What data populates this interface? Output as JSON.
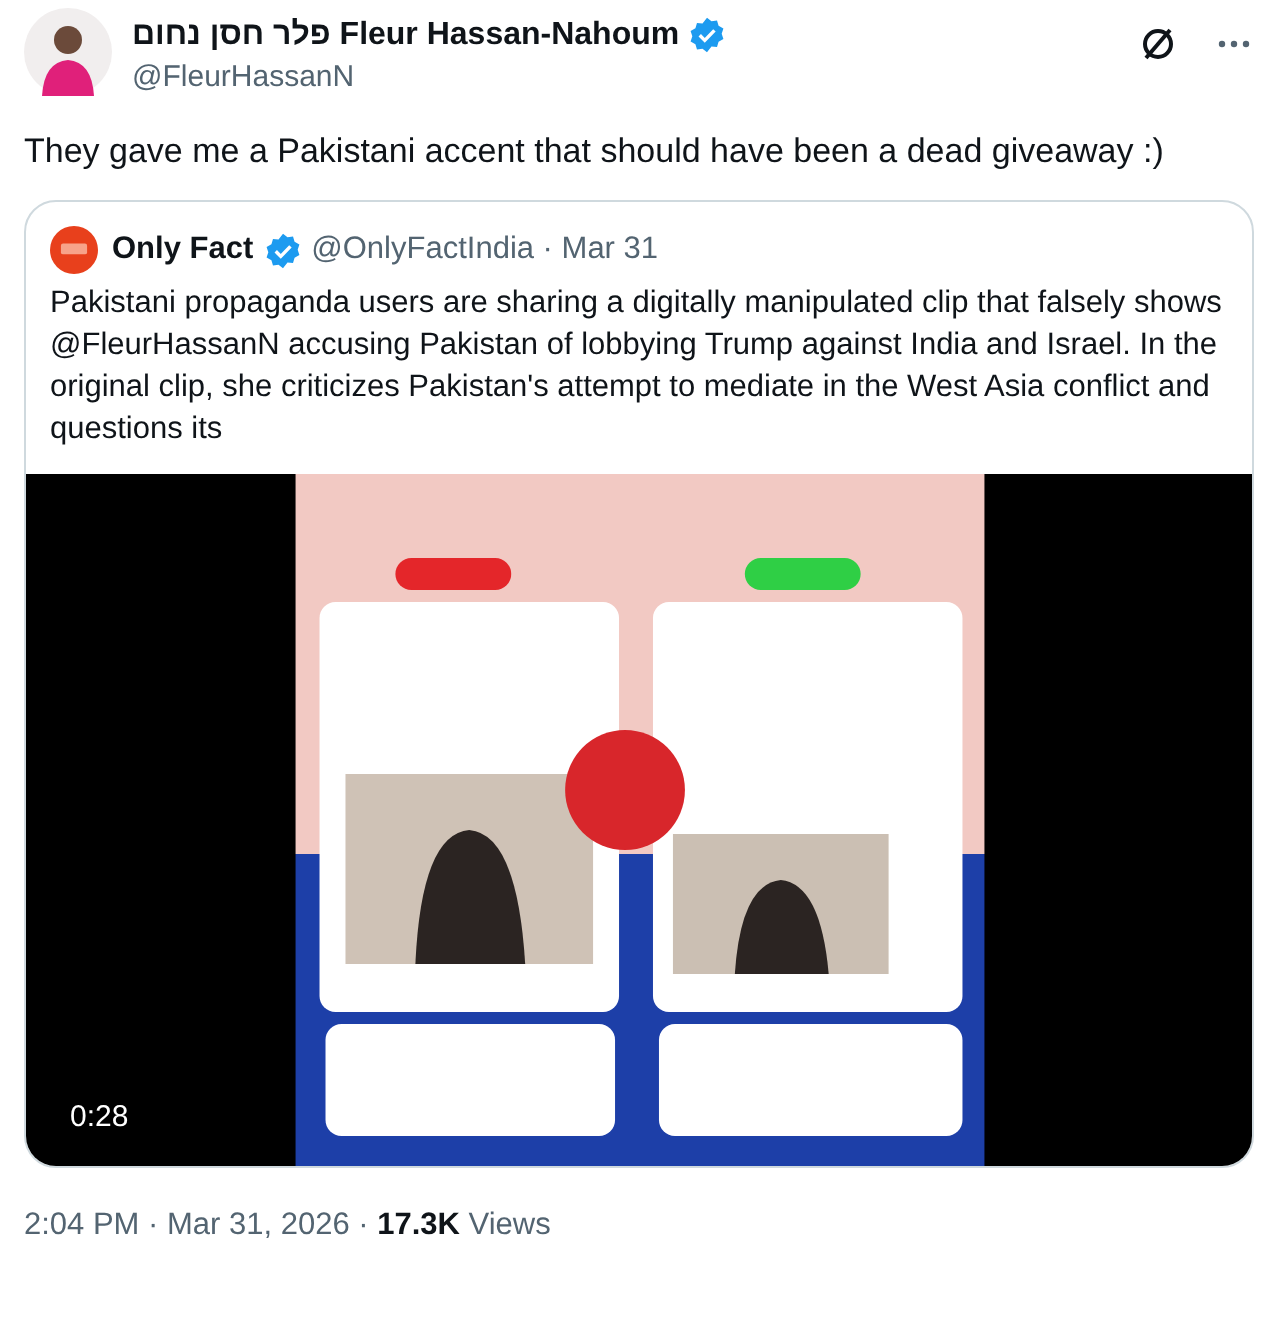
{
  "author": {
    "name": "פלר חסן נחום Fleur Hassan-Nahoum",
    "verified": true,
    "handle": "@FleurHassanN"
  },
  "text": "They gave me a Pakistani accent that should have been a dead giveaway :)",
  "quote": {
    "author": "Only Fact",
    "verified": true,
    "meta": "@OnlyFactIndia · Mar 31",
    "text": "Pakistani propaganda users are sharing a digitally manipulated clip that falsely shows @FleurHassanN accusing Pakistan of lobbying Trump against India and Israel. In the original clip, she criticizes Pakistan's attempt to mediate in the West Asia conflict and questions its",
    "media": {
      "duration": "0:28"
    }
  },
  "footer": "2:04 PM · Mar 31, 2026 · **17.3K** Views"
}
